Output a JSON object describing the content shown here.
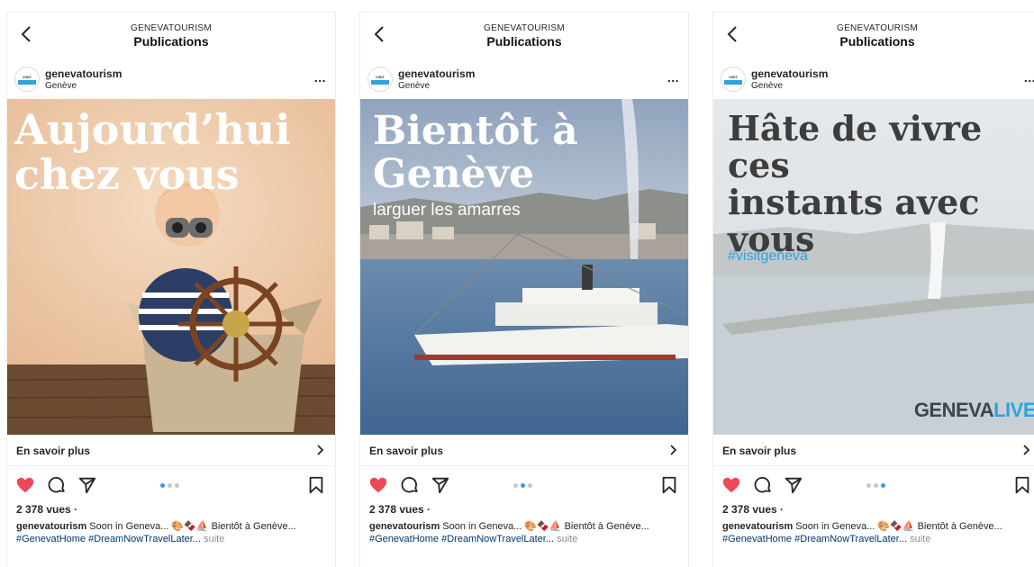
{
  "header": {
    "account_upper": "GENEVATOURISM",
    "title": "Publications"
  },
  "profile": {
    "username": "genevatourism",
    "location": "Genève",
    "avatar_top": "VISIT",
    "avatar_band": "GENEVA"
  },
  "more_glyph": "...",
  "cta": {
    "label": "En savoir plus",
    "chevron": ">"
  },
  "views": "2 378 vues ·",
  "caption": {
    "user": "genevatourism",
    "text": " Soon in Geneva... 🎨🍫⛵ Bientôt à Genève... ",
    "tags": "#GenevatHome #DreamNowTravelLater...",
    "more": " suite"
  },
  "colors": {
    "accent": "#2ea3dc",
    "heart": "#ed4956",
    "dot_active": "#3897f0",
    "dot_inactive": "#c7c7c7",
    "tag_link": "#00376b"
  },
  "icons": [
    "back-chevron-icon",
    "more-options-icon",
    "heart-filled-icon",
    "comment-icon",
    "share-icon",
    "bookmark-icon",
    "chevron-right-icon"
  ],
  "posts": [
    {
      "headline": "Aujourd’hui\nchez vous",
      "active_dot": 0
    },
    {
      "headline": "Bientôt à\nGenève",
      "subline": "larguer les amarres",
      "active_dot": 1
    },
    {
      "headline": "Hâte de vivre ces\ninstants avec\nvous",
      "hashtag": "#visitgeneva",
      "brand_left": "GENEVA",
      "brand_right": "LIVE",
      "active_dot": 2
    }
  ]
}
